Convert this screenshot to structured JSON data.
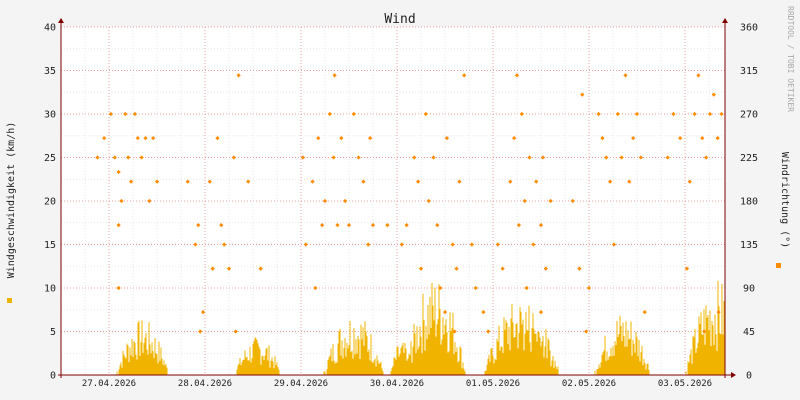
{
  "chart_data": {
    "type": "line",
    "title": "Wind",
    "watermark": "RRDTOOL / TOBI OETIKER",
    "ylabel_left": "Windgeschwindigkeit (km/h)",
    "ylabel_right": "Windrichtung (°)",
    "ylim_left": [
      0,
      40
    ],
    "ylim_right": [
      0,
      360
    ],
    "yticks_left": [
      "0",
      "5",
      "10",
      "15",
      "20",
      "25",
      "30",
      "35",
      "40"
    ],
    "yticks_right": [
      "0",
      "45",
      "90",
      "135",
      "180",
      "225",
      "270",
      "315",
      "360"
    ],
    "xticks": [
      "27.04.2026",
      "28.04.2026",
      "29.04.2026",
      "30.04.2026",
      "01.05.2026",
      "02.05.2026",
      "03.05.2026"
    ],
    "grid": true,
    "colors": {
      "speed": "#f0b400",
      "direction": "#ff8c00",
      "grid_major": "#f0a0a0",
      "grid_minor": "#e6e6e6",
      "axis": "#800000",
      "background": "#ffffff",
      "canvas": "#f4f4f4"
    },
    "speed_bursts": [
      {
        "day": 0.35,
        "width": 0.28,
        "peak": 6.5
      },
      {
        "day": 1.55,
        "width": 0.25,
        "peak": 4.5
      },
      {
        "day": 2.55,
        "width": 0.32,
        "peak": 7.5
      },
      {
        "day": 3.05,
        "width": 0.12,
        "peak": 4.0
      },
      {
        "day": 3.4,
        "width": 0.32,
        "peak": 11.5
      },
      {
        "day": 4.3,
        "width": 0.4,
        "peak": 9.0
      },
      {
        "day": 4.45,
        "width": 0.15,
        "peak": 6.0
      },
      {
        "day": 5.35,
        "width": 0.3,
        "peak": 7.5
      },
      {
        "day": 6.35,
        "width": 0.35,
        "peak": 11.0
      }
    ],
    "direction_points": [
      [
        -0.12,
        225
      ],
      [
        -0.05,
        245
      ],
      [
        0.02,
        270
      ],
      [
        0.06,
        225
      ],
      [
        0.1,
        210
      ],
      [
        0.13,
        180
      ],
      [
        0.17,
        270
      ],
      [
        0.2,
        225
      ],
      [
        0.23,
        200
      ],
      [
        0.27,
        270
      ],
      [
        0.3,
        245
      ],
      [
        0.34,
        225
      ],
      [
        0.38,
        245
      ],
      [
        0.42,
        180
      ],
      [
        0.46,
        245
      ],
      [
        0.5,
        200
      ],
      [
        0.1,
        90
      ],
      [
        0.1,
        155
      ],
      [
        0.82,
        200
      ],
      [
        0.9,
        135
      ],
      [
        0.93,
        155
      ],
      [
        0.98,
        65
      ],
      [
        1.05,
        200
      ],
      [
        1.08,
        110
      ],
      [
        1.13,
        245
      ],
      [
        1.17,
        155
      ],
      [
        1.2,
        135
      ],
      [
        1.25,
        110
      ],
      [
        1.3,
        225
      ],
      [
        1.35,
        310
      ],
      [
        1.45,
        200
      ],
      [
        1.32,
        45
      ],
      [
        0.95,
        45
      ],
      [
        1.58,
        110
      ],
      [
        2.02,
        225
      ],
      [
        2.05,
        135
      ],
      [
        2.12,
        200
      ],
      [
        2.18,
        245
      ],
      [
        2.22,
        155
      ],
      [
        2.25,
        180
      ],
      [
        2.3,
        270
      ],
      [
        2.34,
        225
      ],
      [
        2.38,
        155
      ],
      [
        2.42,
        245
      ],
      [
        2.46,
        180
      ],
      [
        2.5,
        155
      ],
      [
        2.55,
        270
      ],
      [
        2.6,
        225
      ],
      [
        2.65,
        200
      ],
      [
        2.7,
        135
      ],
      [
        2.72,
        245
      ],
      [
        2.75,
        155
      ],
      [
        2.35,
        310
      ],
      [
        2.15,
        90
      ],
      [
        2.9,
        155
      ],
      [
        3.05,
        135
      ],
      [
        3.1,
        155
      ],
      [
        3.18,
        225
      ],
      [
        3.22,
        200
      ],
      [
        3.25,
        110
      ],
      [
        3.3,
        270
      ],
      [
        3.33,
        180
      ],
      [
        3.38,
        225
      ],
      [
        3.42,
        155
      ],
      [
        3.45,
        90
      ],
      [
        3.5,
        65
      ],
      [
        3.52,
        245
      ],
      [
        3.58,
        135
      ],
      [
        3.62,
        110
      ],
      [
        3.65,
        200
      ],
      [
        3.7,
        310
      ],
      [
        3.78,
        135
      ],
      [
        3.82,
        90
      ],
      [
        3.9,
        65
      ],
      [
        3.95,
        45
      ],
      [
        3.6,
        45
      ],
      [
        4.05,
        135
      ],
      [
        4.1,
        110
      ],
      [
        4.18,
        200
      ],
      [
        4.22,
        245
      ],
      [
        4.27,
        155
      ],
      [
        4.3,
        270
      ],
      [
        4.33,
        180
      ],
      [
        4.38,
        225
      ],
      [
        4.42,
        135
      ],
      [
        4.45,
        200
      ],
      [
        4.5,
        155
      ],
      [
        4.52,
        225
      ],
      [
        4.55,
        110
      ],
      [
        4.6,
        180
      ],
      [
        4.25,
        310
      ],
      [
        4.35,
        90
      ],
      [
        4.5,
        65
      ],
      [
        4.83,
        180
      ],
      [
        4.9,
        110
      ],
      [
        4.93,
        290
      ],
      [
        4.97,
        45
      ],
      [
        5.0,
        90
      ],
      [
        5.1,
        270
      ],
      [
        5.14,
        245
      ],
      [
        5.18,
        225
      ],
      [
        5.22,
        200
      ],
      [
        5.26,
        135
      ],
      [
        5.3,
        270
      ],
      [
        5.34,
        225
      ],
      [
        5.38,
        310
      ],
      [
        5.42,
        200
      ],
      [
        5.46,
        245
      ],
      [
        5.5,
        270
      ],
      [
        5.54,
        225
      ],
      [
        5.58,
        65
      ],
      [
        5.82,
        225
      ],
      [
        5.88,
        270
      ],
      [
        5.95,
        245
      ],
      [
        6.02,
        110
      ],
      [
        6.05,
        200
      ],
      [
        6.1,
        270
      ],
      [
        6.14,
        310
      ],
      [
        6.18,
        245
      ],
      [
        6.22,
        225
      ],
      [
        6.26,
        270
      ],
      [
        6.3,
        290
      ],
      [
        6.34,
        245
      ],
      [
        6.38,
        270
      ],
      [
        6.42,
        225
      ],
      [
        6.46,
        290
      ],
      [
        6.5,
        270
      ],
      [
        6.54,
        245
      ],
      [
        6.58,
        200
      ],
      [
        6.62,
        330
      ],
      [
        6.2,
        45
      ],
      [
        6.35,
        65
      ]
    ]
  }
}
